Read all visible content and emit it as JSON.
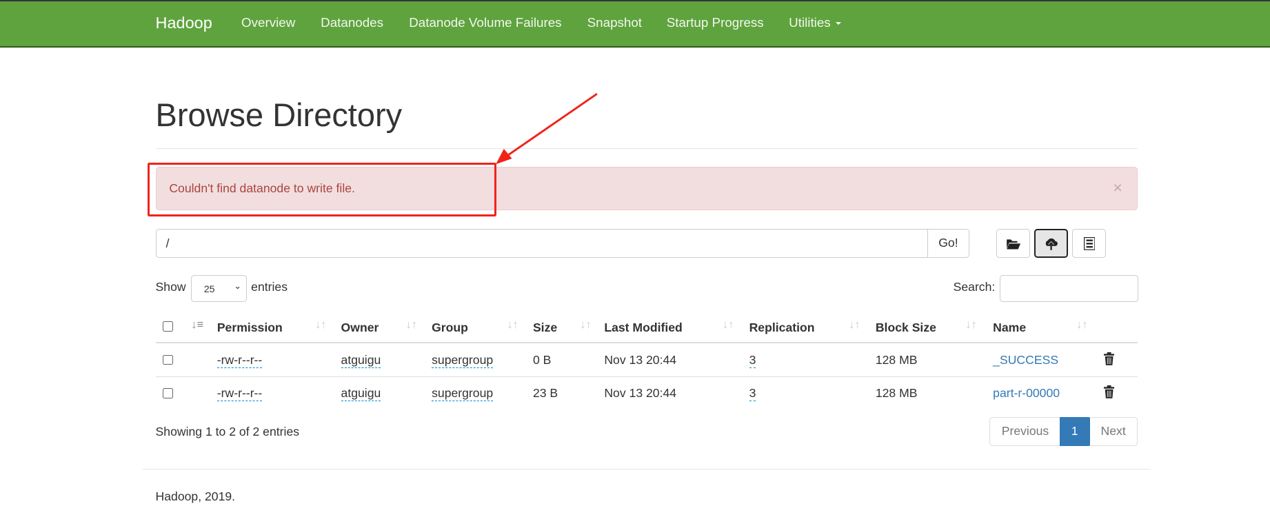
{
  "navbar": {
    "brand": "Hadoop",
    "items": [
      "Overview",
      "Datanodes",
      "Datanode Volume Failures",
      "Snapshot",
      "Startup Progress",
      "Utilities"
    ]
  },
  "page_title": "Browse Directory",
  "alert": {
    "message": "Couldn't find datanode to write file.",
    "close": "×"
  },
  "path_bar": {
    "value": "/",
    "go_label": "Go!"
  },
  "toolbar": {
    "icons": [
      "folder-open-icon",
      "cloud-upload-icon",
      "list-icon"
    ],
    "active": "cloud-upload-icon"
  },
  "length": {
    "show": "Show",
    "value": "25",
    "entries": "entries"
  },
  "search": {
    "label": "Search:",
    "value": ""
  },
  "table": {
    "columns": [
      "Permission",
      "Owner",
      "Group",
      "Size",
      "Last Modified",
      "Replication",
      "Block Size",
      "Name"
    ],
    "rows": [
      {
        "permission": "-rw-r--r--",
        "owner": "atguigu",
        "group": "supergroup",
        "size": "0 B",
        "modified": "Nov 13 20:44",
        "replication": "3",
        "block_size": "128 MB",
        "name": "_SUCCESS"
      },
      {
        "permission": "-rw-r--r--",
        "owner": "atguigu",
        "group": "supergroup",
        "size": "23 B",
        "modified": "Nov 13 20:44",
        "replication": "3",
        "block_size": "128 MB",
        "name": "part-r-00000"
      }
    ]
  },
  "info": "Showing 1 to 2 of 2 entries",
  "pagination": {
    "previous": "Previous",
    "current": "1",
    "next": "Next",
    "active_color": "#337ab7"
  },
  "footer": "Hadoop, 2019.",
  "colors": {
    "navbar": "#5fa33e",
    "alert_bg": "#f2dede",
    "alert_text": "#a94442",
    "annotation": "#f0231b",
    "link": "#337ab7"
  }
}
